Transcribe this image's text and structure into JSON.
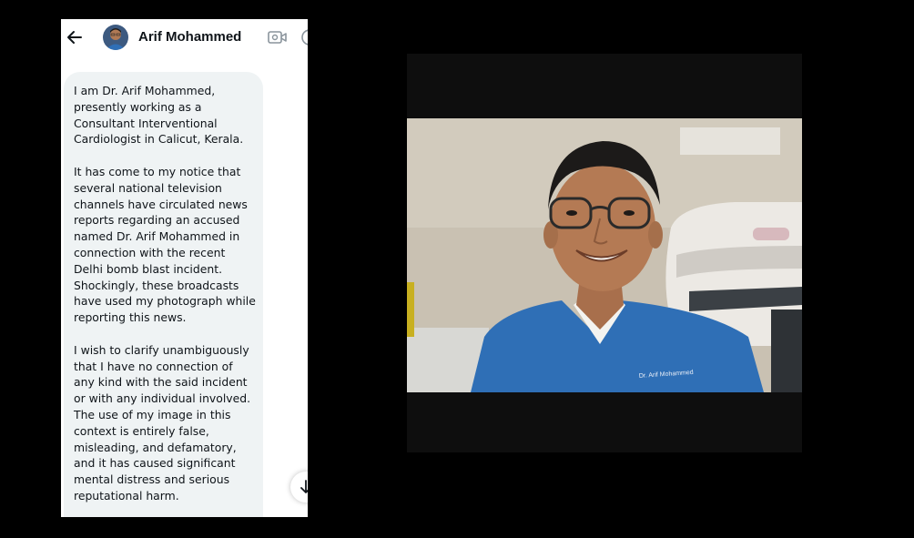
{
  "chat": {
    "header": {
      "contact_name": "Arif Mohammed",
      "back_icon": "arrow-left-icon",
      "video_icon": "video-camera-icon",
      "info_icon": "info-icon"
    },
    "message": {
      "paragraphs": [
        "I am Dr. Arif Mohammed,\npresently working as a\nConsultant Interventional\nCardiologist in Calicut, Kerala.",
        "It has come to my notice that\nseveral national television\nchannels have circulated news\nreports regarding an accused\nnamed Dr. Arif Mohammed in\nconnection with the recent\nDelhi bomb blast incident.\nShockingly, these broadcasts\nhave used my photograph while\nreporting this news.",
        "I wish to clarify unambiguously\nthat I have no connection of\nany kind with the said incident\nor with any individual involved.\nThe use of my image in this\ncontext is entirely false,\nmisleading, and defamatory,\nand it has caused significant\nmental distress and serious\nreputational harm."
      ]
    },
    "scroll_icon": "arrow-down-icon"
  },
  "photo": {
    "scrub_badge_text": "Dr. Arif Mohammed"
  },
  "colors": {
    "background": "#000000",
    "chat_bg": "#ffffff",
    "bubble_bg": "#eff3f4",
    "text": "#0f1419",
    "scrubs": "#2f6fb6"
  }
}
